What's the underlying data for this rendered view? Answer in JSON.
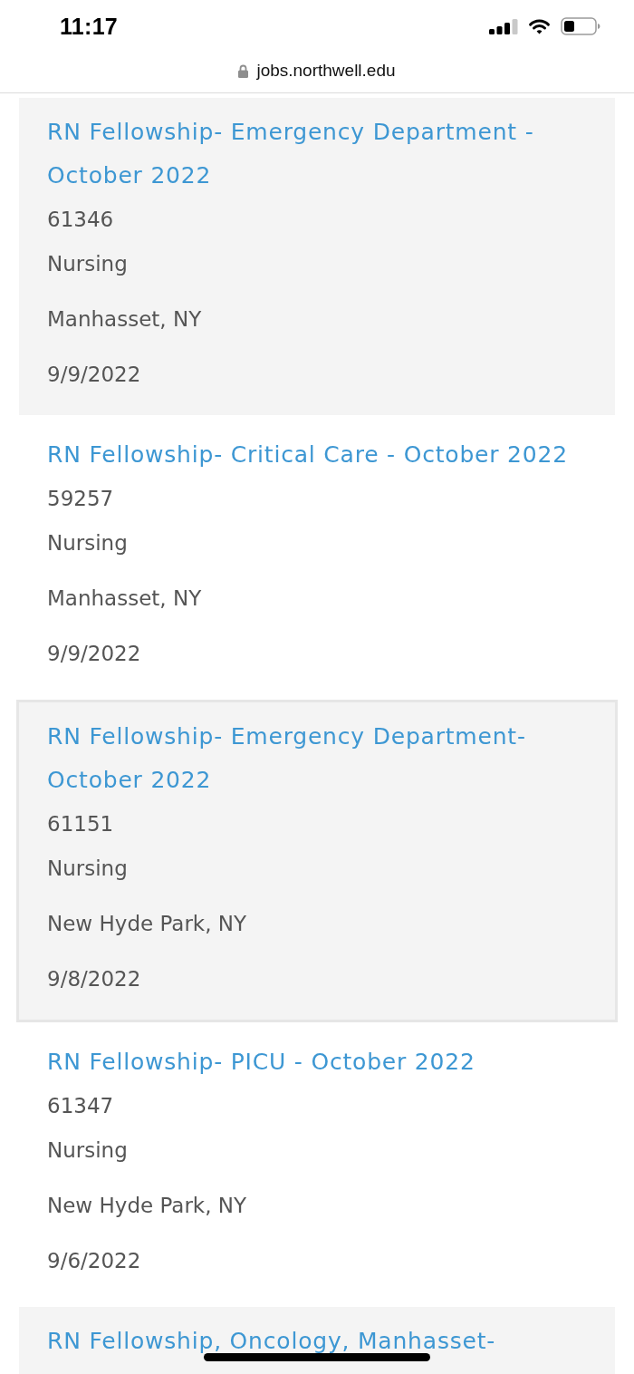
{
  "status_bar": {
    "time": "11:17"
  },
  "address_bar": {
    "url": "jobs.northwell.edu"
  },
  "jobs": [
    {
      "title": "RN Fellowship- Emergency Department - October 2022",
      "id": "61346",
      "category": "Nursing",
      "location": "Manhasset, NY",
      "date": "9/9/2022",
      "selected": false
    },
    {
      "title": "RN Fellowship- Critical Care - October 2022",
      "id": "59257",
      "category": "Nursing",
      "location": "Manhasset, NY",
      "date": "9/9/2022",
      "selected": false
    },
    {
      "title": "RN Fellowship- Emergency Department- October 2022",
      "id": "61151",
      "category": "Nursing",
      "location": "New Hyde Park, NY",
      "date": "9/8/2022",
      "selected": true
    },
    {
      "title": "RN Fellowship- PICU - October 2022",
      "id": "61347",
      "category": "Nursing",
      "location": "New Hyde Park, NY",
      "date": "9/6/2022",
      "selected": false
    },
    {
      "title": "RN Fellowship, Oncology, Manhasset-",
      "selected": false
    }
  ]
}
